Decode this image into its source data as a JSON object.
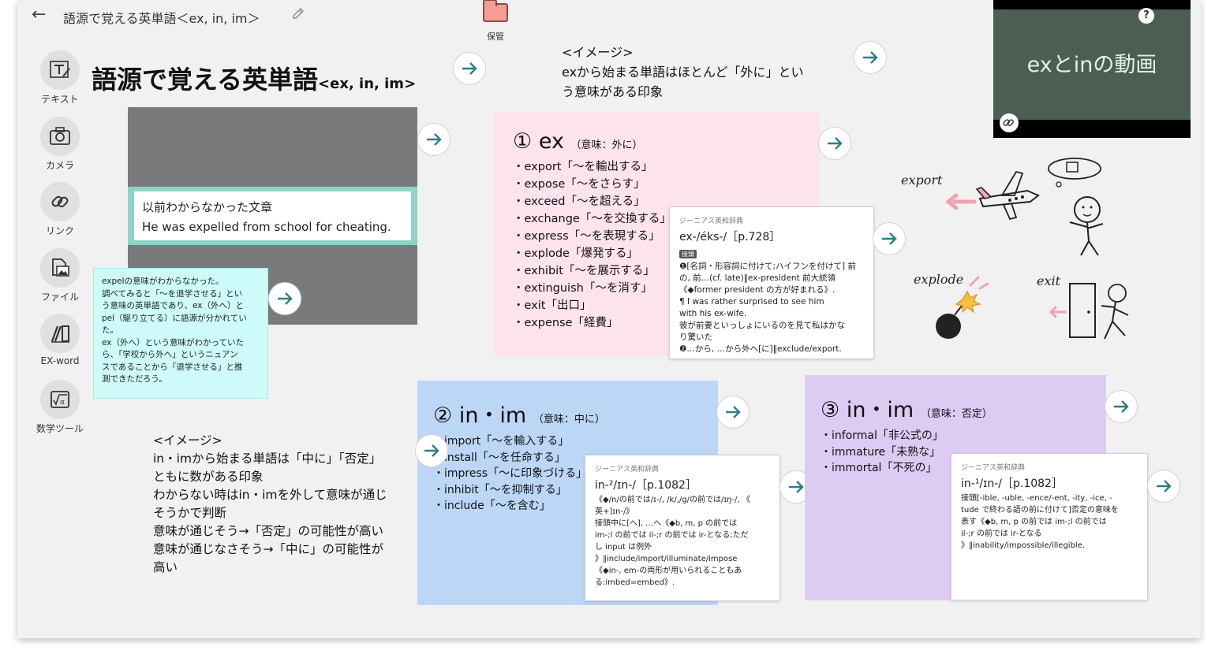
{
  "header": {
    "back_icon": "arrow-left-icon",
    "doc_title": "語源で覚える英単語＜ex, in, im＞",
    "edit_icon": "pencil-icon",
    "storage_label": "保管"
  },
  "toolbar": [
    {
      "label": "テキスト",
      "icon": "text-tool-icon"
    },
    {
      "label": "カメラ",
      "icon": "camera-icon"
    },
    {
      "label": "リンク",
      "icon": "link-icon"
    },
    {
      "label": "ファイル",
      "icon": "file-image-icon"
    },
    {
      "label": "EX-word",
      "icon": "dictionary-icon"
    },
    {
      "label": "数学ツール",
      "icon": "math-tool-icon"
    }
  ],
  "board": {
    "title_main": "語源で覚える英単語",
    "title_sub": "<ex, in, im>",
    "sentence_card": {
      "line1": "以前わからなかった文章",
      "line2": "He was expelled from school for cheating."
    },
    "note": {
      "lines": [
        "expelの意味がわからなかった。",
        "調べてみると「〜を退学させる」とい",
        "う意味の英単語であり、ex（外へ）と",
        "pel（駆り立てる）に語源が分かれてい",
        "た。",
        "ex（外へ）という意味がわかっていた",
        "ら、「学校から外へ」というニュアン",
        "スであることから「退学させる」と推",
        "測できただろう。"
      ]
    },
    "image_ex": {
      "heading": "<イメージ>",
      "line1": "exから始まる単語はほとんど「外に」とい",
      "line2": "う意味がある印象"
    },
    "image_in": {
      "heading": "<イメージ>",
      "lines": [
        "in・imから始まる単語は「中に」「否定」",
        "ともに数がある印象",
        "わからない時はin・imを外して意味が通じ",
        "そうかで判断",
        "意味が通じそう→「否定」の可能性が高い",
        "意味が通じなさそう→「中に」の可能性が",
        "高い"
      ]
    },
    "card_ex": {
      "num": "①",
      "prefix": "ex",
      "meaning": "（意味：外に）",
      "words": [
        "export「〜を輸出する」",
        "expose「〜をさらす」",
        "exceed「〜を超える」",
        "exchange「〜を交換する」",
        "express「〜を表現する」",
        "explode「爆発する」",
        "exhibit「〜を展示する」",
        "extinguish「〜を消す」",
        "exit「出口」",
        "expense「経費」"
      ]
    },
    "card_in1": {
      "num": "②",
      "prefix": "in・im",
      "meaning": "（意味：中に）",
      "words": [
        "import「〜を輸入する」",
        "install「〜を任命する」",
        "impress「〜に印象づける」",
        "inhibit「〜を抑制する」",
        "include「〜を含む」"
      ]
    },
    "card_in2": {
      "num": "③",
      "prefix": "in・im",
      "meaning": "（意味：否定）",
      "words": [
        "informal「非公式の」",
        "immature「未熟な」",
        "immortal「不死の」"
      ]
    },
    "dict_ex": {
      "source": "ジーニアス英和辞典",
      "head": "ex-/éks-/［p.728］",
      "tag": "接頭",
      "lines": [
        "❶[名詞・形容詞に付けて;ハイフンを付けて] 前",
        "の, 前…(cf. late)‖ex-president 前大統領",
        "《◆former president の方が好まれる》.",
        "¶ I was rather surprised to see him",
        "with his ex-wife.",
        "彼が前妻といっしょにいるのを見て私はかな",
        "り驚いた",
        "❷…から, …から外へ[に]‖exclude/export."
      ]
    },
    "dict_in1": {
      "source": "ジーニアス英和辞典",
      "head": "in-²/ɪn-/［p.1082］",
      "lines": [
        "《◆/n/の前では/ɪ-/, /k/,/g/の前では/ɪŋ-/, 《",
        "英+]ɪn-/》",
        "接頭中に[へ], …へ《◆b, m, p の前では",
        "im-;l の前では il-;r の前では ir-となる;ただ",
        "し input は例外",
        "》‖include/import/illuminate/impose",
        "《◆in-, em-の両形が用いられることもあ",
        "る:imbed=embed》."
      ]
    },
    "dict_in2": {
      "source": "ジーニアス英和辞典",
      "head": "in-¹/ɪn-/［p.1082］",
      "lines": [
        "接頭[-ible, -uble, -ence/-ent, -ity, -ice, -",
        "tude で終わる語の前に付けて]否定の意味を",
        "表す《◆b, m, p の前では im-;l の前では",
        "il-;r の前では ir-となる",
        "》‖inability/impossible/illegible."
      ]
    },
    "video": {
      "title": "exとinの動画",
      "help_icon": "?"
    },
    "sketch_labels": {
      "export": "export",
      "explode": "explode",
      "exit": "exit"
    }
  }
}
